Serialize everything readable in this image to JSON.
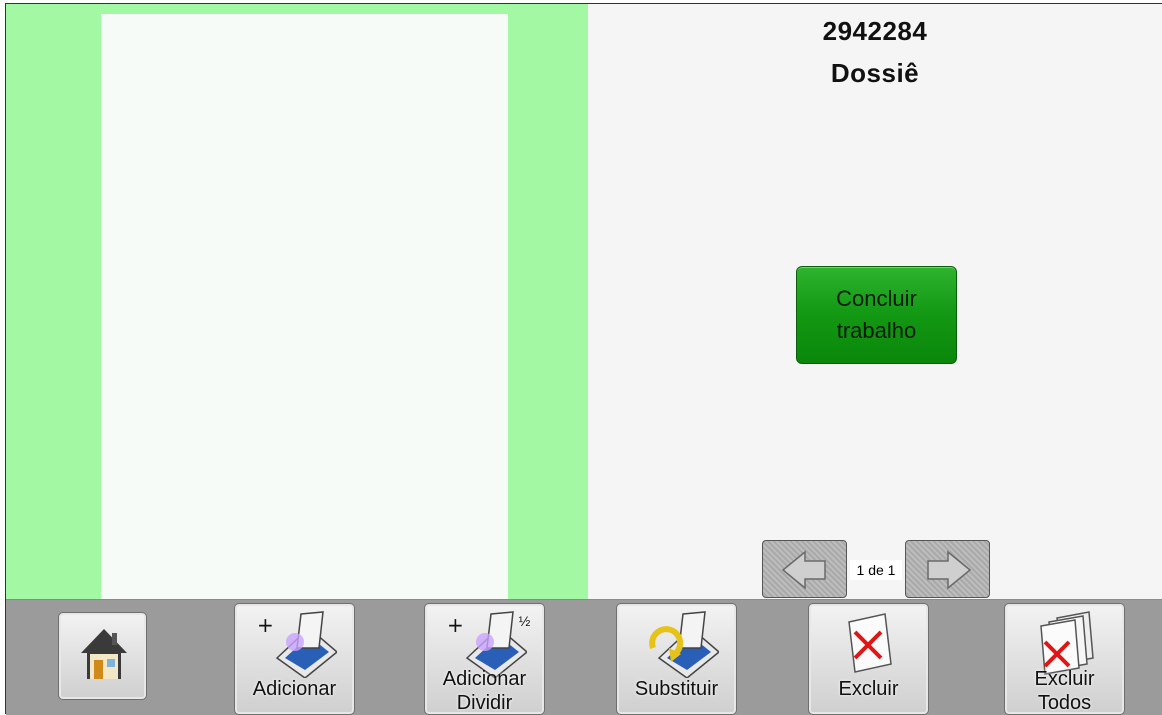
{
  "document": {
    "number": "2942284",
    "type": "Dossiê"
  },
  "actions": {
    "finish_label": "Concluir\ntrabalho"
  },
  "pagination": {
    "indicator": "1 de 1",
    "current": 1,
    "total": 1
  },
  "toolbar": {
    "add_label": "Adicionar",
    "add_split_label_1": "Adicionar",
    "add_split_label_2": "Dividir",
    "add_split_badge": "½",
    "replace_label": "Substituir",
    "delete_label": "Excluir",
    "delete_all_label_1": "Excluir",
    "delete_all_label_2": "Todos"
  },
  "colors": {
    "preview_bg": "#a3f9a3",
    "finish_button": "#149a14",
    "toolbar_bg": "#9b9b9b"
  }
}
